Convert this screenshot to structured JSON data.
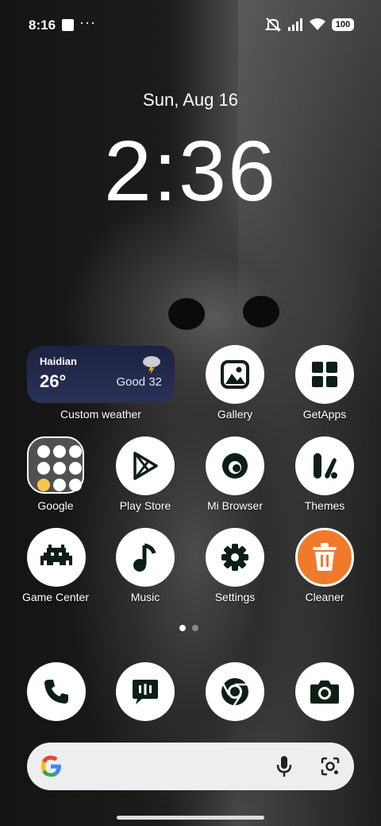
{
  "status_bar": {
    "time": "8:16",
    "overflow": "···",
    "battery": "100"
  },
  "lock": {
    "date": "Sun, Aug 16",
    "time": "2:36"
  },
  "weather": {
    "city": "Haidian",
    "temp": "26°",
    "aqi": "Good 32",
    "label": "Custom weather"
  },
  "apps": {
    "gallery": "Gallery",
    "getapps": "GetApps",
    "google": "Google",
    "playstore": "Play Store",
    "browser": "Mi Browser",
    "themes": "Themes",
    "gamecenter": "Game Center",
    "music": "Music",
    "settings": "Settings",
    "cleaner": "Cleaner"
  },
  "dock": [
    "phone-icon",
    "messages-icon",
    "chrome-icon",
    "camera-icon"
  ],
  "colors": {
    "cleaner": "#f07a2a",
    "icon_dark": "#0c1f14"
  }
}
